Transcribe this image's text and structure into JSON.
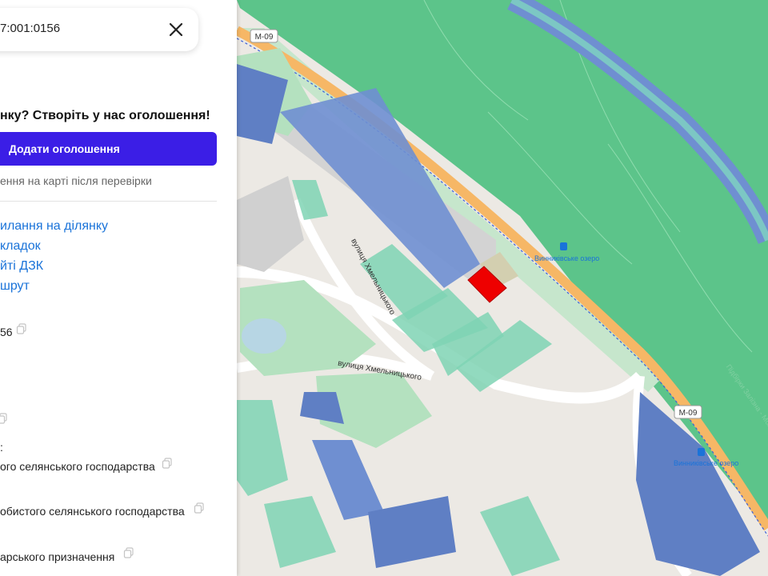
{
  "search": {
    "value": "7:001:0156"
  },
  "promo": {
    "heading": "нку? Створіть у нас оголошення!",
    "button_label": "Додати оголошення",
    "note": "ення на карті після перевірки"
  },
  "actions": [
    {
      "label": "илання на ділянку"
    },
    {
      "label": "кладок"
    },
    {
      "label": "йті ДЗК"
    },
    {
      "label": "шрут"
    }
  ],
  "info": {
    "cadastral_tail": "56",
    "purpose_prefix": ":",
    "purpose_line1": "ого селянського господарства",
    "purpose_line2": "обистого селянського господарства",
    "category": "арського призначення"
  },
  "map": {
    "road_badges": [
      {
        "label": "M-09"
      },
      {
        "label": "M-09"
      }
    ],
    "street_labels": [
      {
        "label": "вулиця Хмельницького"
      },
      {
        "label": "вулиця Хмельницького"
      }
    ],
    "stops": [
      {
        "label": "Винниківське озеро"
      },
      {
        "label": "Винниківське озеро"
      }
    ],
    "faint_labels": [
      {
        "label": "Підбірки Залізна - Молотка"
      }
    ],
    "colors": {
      "forest": "#5cc48a",
      "water": "#b7d6e4",
      "road": "#f6b766",
      "parcel_blue": "#6f8fd1",
      "parcel_green": "#7fd4b4",
      "selected_parcel": "#ee0000",
      "accent_button": "#3b1ee6",
      "link": "#1a73d9"
    }
  }
}
